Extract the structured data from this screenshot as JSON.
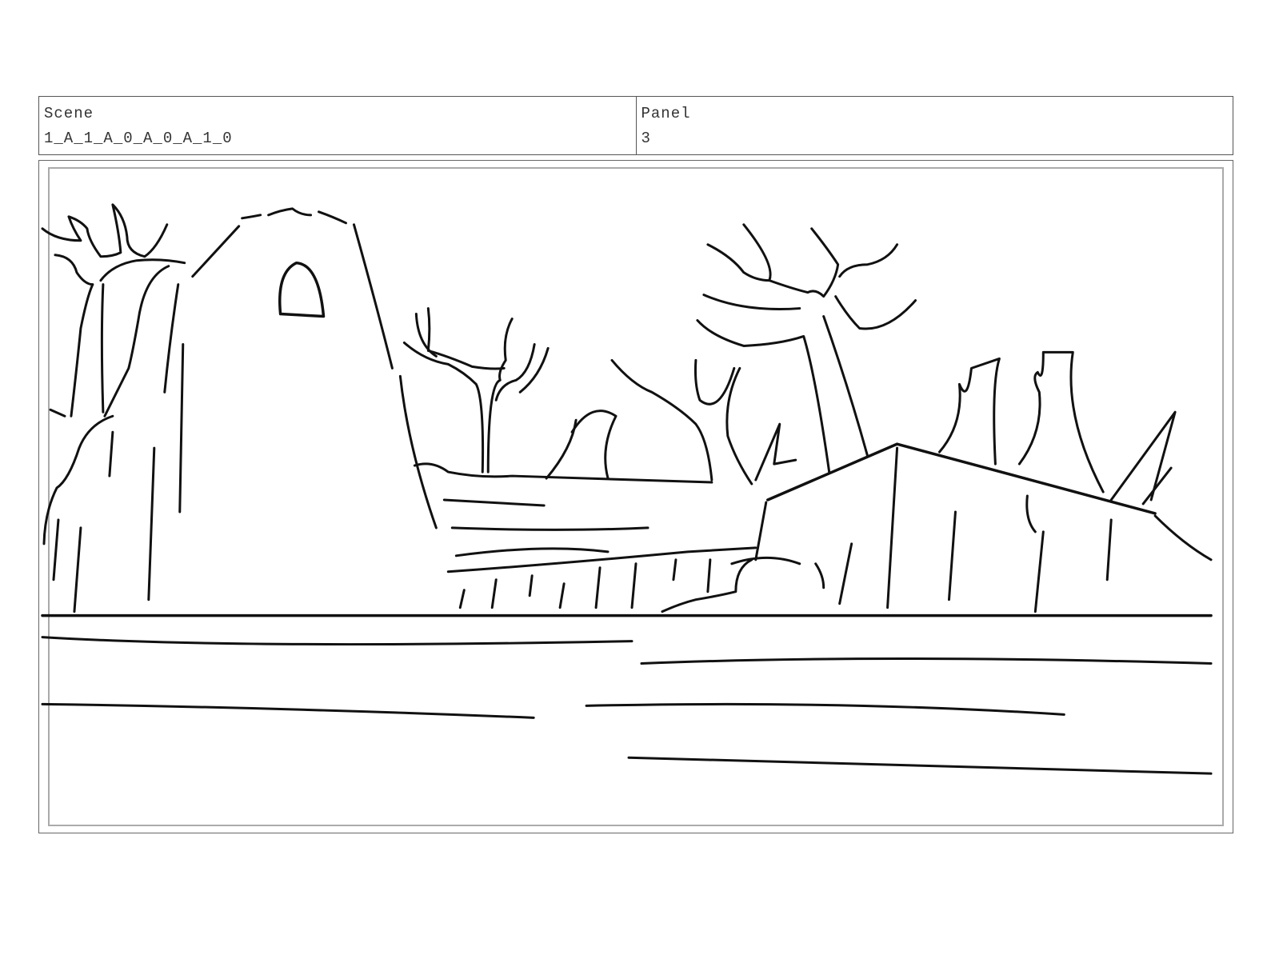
{
  "header": {
    "scene_label": "Scene",
    "scene_value": "1_A_1_A_0_A_0_A_1_0",
    "panel_label": "Panel",
    "panel_value": "3"
  },
  "panel": {
    "line_color": "#111111",
    "frame_color": "#666666"
  }
}
